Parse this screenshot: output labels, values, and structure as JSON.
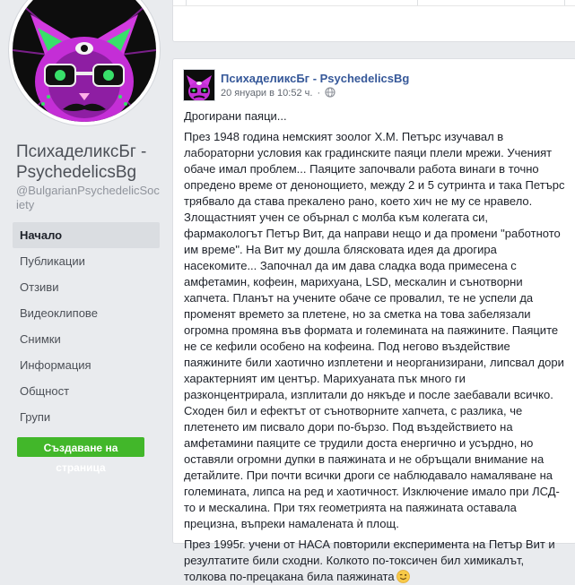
{
  "page": {
    "name": "ПсихаделиксБг - PsychedelicsBg",
    "handle": "@BulgarianPsychedelicSociety"
  },
  "nav": {
    "items": [
      {
        "label": "Начало",
        "active": true
      },
      {
        "label": "Публикации"
      },
      {
        "label": "Отзиви"
      },
      {
        "label": "Видеоклипове"
      },
      {
        "label": "Снимки"
      },
      {
        "label": "Информация"
      },
      {
        "label": "Общност"
      },
      {
        "label": "Групи"
      }
    ],
    "create_button": "Създаване на страница"
  },
  "post": {
    "author": "ПсихаделиксБг - PsychedelicsBg",
    "timestamp": "20 януари в 10:52 ч.",
    "separator": "·",
    "audience_icon": "globe-icon",
    "title_line": "Дрогирани паяци...",
    "paragraph1": "През 1948 година немският зоолог Х.М. Петърс изучавал в лабораторни условия как градинските паяци плели мрежи. Ученият обаче имал проблем... Паяците започвали работа винаги в точно опредено време от денонощието, между 2 и 5 сутринта и така Петърс трябвало да става прекалено рано, което хич не му се нравело. Злощастният учен се обърнал с молба към колегата си, фармакологът Петър Вит, да направи нещо и да промени \"работното им време\". На Вит му дошла блясковата идея да дрогира насекомите... Започнал да им дава сладка вода примесена с амфетамин, кофеин, марихуана, LSD, мескалин и сънотворни хапчета. Планът на учените обаче се провалил, те не успели да променят времето за плетене, но за сметка на това забелязали огромна промяна във формата и големината на паяжините. Паяците не се кефили особено на кофеина. Под негово въздействие паяжините били хаотично изплетени и неорганизирани, липсвал дори характерният им център. Марихуаната пък много ги разконцентрирала, изплитали до някъде и после заебавали всичко. Сходен бил и ефектът от сънотворните хапчета, с разлика, че плетенето им писвало дори по-бързо. Под въздействието на амфетамини паяците се трудили доста енергично и усърдно, но оставяли огромни дупки в паяжината и не обръщали внимание на детайлите. При почти всички дроги се наблюдавало намаляване на големината, липса на ред и хаотичност. Изключение имало при ЛСД-то и мескалина. При тях геометрията на паяжината оставала прецизна, въпреки намалената ѝ площ.",
    "paragraph2": "През 1995г. учени от НАСА повторили експеримента на Петър Вит и резултатите били сходни. Колкото по-токсичен бил химикалът, толкова по-прецакана била паяжината",
    "emoji": "wink-emoji"
  },
  "colors": {
    "background": "#e9ebee",
    "link": "#365899",
    "green_button": "#42b72a",
    "avatar_magenta": "#d23be0",
    "avatar_green": "#38e06a"
  }
}
